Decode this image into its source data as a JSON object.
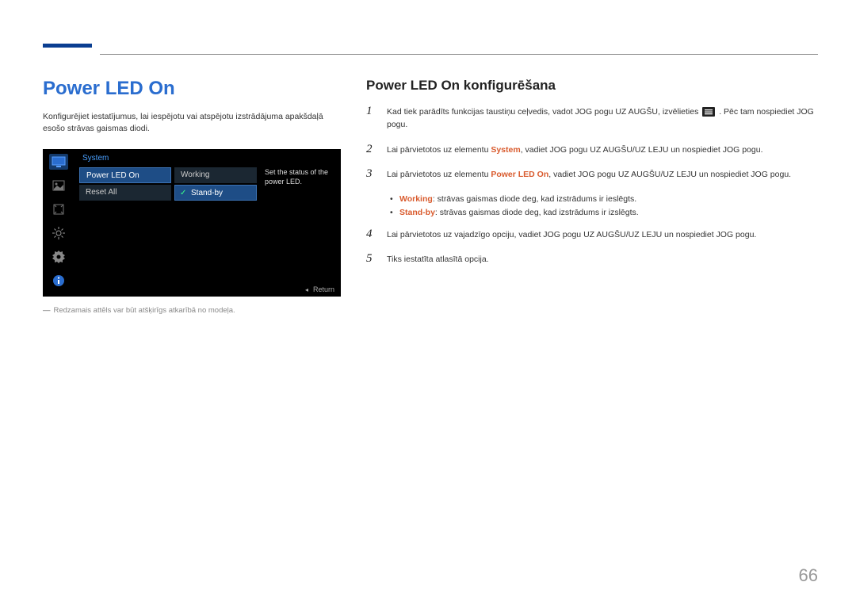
{
  "left": {
    "title": "Power LED On",
    "intro": "Konfigurējiet iestatījumus, lai iespējotu vai atspējotu izstrādājuma apakšdaļā esošo strāvas gaismas diodi.",
    "footnote": "Redzamais attēls var būt atšķirīgs atkarībā no modeļa."
  },
  "osd": {
    "breadcrumb": "System",
    "items_left": [
      "Power LED On",
      "Reset All"
    ],
    "items_right": [
      "Working",
      "Stand-by"
    ],
    "desc": "Set the status of the power LED.",
    "return": "Return"
  },
  "right": {
    "subtitle": "Power LED On konfigurēšana",
    "steps": {
      "s1a": "Kad tiek parādīts funkcijas taustiņu ceļvedis, vadot JOG pogu UZ AUGŠU, izvēlieties",
      "s1b": ". Pēc tam nospiediet JOG pogu.",
      "s2a": "Lai pārvietotos uz elementu ",
      "s2hl": "System",
      "s2b": ", vadiet JOG pogu UZ AUGŠU/UZ LEJU un nospiediet JOG pogu.",
      "s3a": "Lai pārvietotos uz elementu ",
      "s3hl": "Power LED On",
      "s3b": ", vadiet JOG pogu UZ AUGŠU/UZ LEJU un nospiediet JOG pogu.",
      "sub1hl": "Working",
      "sub1": ": strāvas gaismas diode deg, kad izstrādums ir ieslēgts.",
      "sub2hl": "Stand-by",
      "sub2": ": strāvas gaismas diode deg, kad izstrādums ir izslēgts.",
      "s4": "Lai pārvietotos uz vajadzīgo opciju, vadiet JOG pogu UZ AUGŠU/UZ LEJU un nospiediet JOG pogu.",
      "s5": "Tiks iestatīta atlasītā opcija."
    }
  },
  "page_number": "66"
}
